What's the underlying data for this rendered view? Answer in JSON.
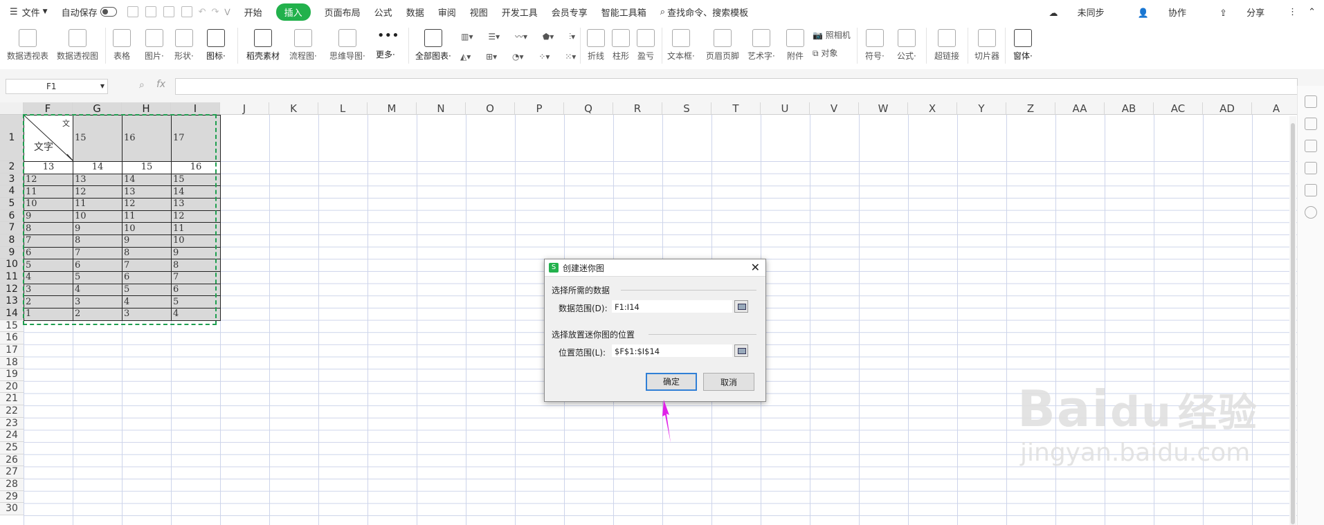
{
  "menubar": {
    "file_label": "文件",
    "autosave_label": "自动保存",
    "tabs": [
      {
        "label": "开始"
      },
      {
        "label": "插入"
      },
      {
        "label": "页面布局"
      },
      {
        "label": "公式"
      },
      {
        "label": "数据"
      },
      {
        "label": "审阅"
      },
      {
        "label": "视图"
      },
      {
        "label": "开发工具"
      },
      {
        "label": "会员专享"
      },
      {
        "label": "智能工具箱"
      }
    ],
    "search_placeholder": "查找命令、搜索模板",
    "right_items": [
      {
        "label": "未同步"
      },
      {
        "label": "协作"
      },
      {
        "label": "分享"
      }
    ]
  },
  "ribbon": {
    "buttons": [
      {
        "label": "数据透视表"
      },
      {
        "label": "数据透视图"
      },
      {
        "label": "表格"
      },
      {
        "label": "图片·"
      },
      {
        "label": "形状·"
      },
      {
        "label": "图标·"
      },
      {
        "label": "稻壳素材"
      },
      {
        "label": "流程图·"
      },
      {
        "label": "思维导图·"
      },
      {
        "label": "更多·"
      },
      {
        "label": "全部图表·"
      },
      {
        "label": "折线"
      },
      {
        "label": "柱形"
      },
      {
        "label": "盈亏"
      },
      {
        "label": "文本框·"
      },
      {
        "label": "页眉页脚"
      },
      {
        "label": "艺术字·"
      },
      {
        "label": "附件"
      },
      {
        "label": "照相机"
      },
      {
        "label": "对象"
      },
      {
        "label": "符号·"
      },
      {
        "label": "公式·"
      },
      {
        "label": "超链接"
      },
      {
        "label": "切片器"
      },
      {
        "label": "窗体·"
      }
    ]
  },
  "formula_bar": {
    "name_box": "F1",
    "fx_label": "fx",
    "formula": ""
  },
  "columns": [
    "F",
    "G",
    "H",
    "I",
    "J",
    "K",
    "L",
    "M",
    "N",
    "O",
    "P",
    "Q",
    "R",
    "S",
    "T",
    "U",
    "V",
    "W",
    "X",
    "Y",
    "Z",
    "AA",
    "AB",
    "AC",
    "AD",
    "A"
  ],
  "rows": [
    "1",
    "2",
    "3",
    "4",
    "5",
    "6",
    "7",
    "8",
    "9",
    "10",
    "11",
    "12",
    "13",
    "14",
    "15",
    "16",
    "17",
    "18",
    "19",
    "20",
    "21",
    "22",
    "23",
    "24",
    "25",
    "26",
    "27",
    "28",
    "29",
    "30"
  ],
  "table": {
    "diag_text": "文字",
    "diag_corner": "文",
    "row1": [
      "15",
      "16",
      "17"
    ],
    "row2": [
      "13",
      "14",
      "15",
      "16"
    ],
    "data": [
      [
        "12",
        "13",
        "14",
        "15"
      ],
      [
        "11",
        "12",
        "13",
        "14"
      ],
      [
        "10",
        "11",
        "12",
        "13"
      ],
      [
        "9",
        "10",
        "11",
        "12"
      ],
      [
        "8",
        "9",
        "10",
        "11"
      ],
      [
        "7",
        "8",
        "9",
        "10"
      ],
      [
        "6",
        "7",
        "8",
        "9"
      ],
      [
        "5",
        "6",
        "7",
        "8"
      ],
      [
        "4",
        "5",
        "6",
        "7"
      ],
      [
        "3",
        "4",
        "5",
        "6"
      ],
      [
        "2",
        "3",
        "4",
        "5"
      ],
      [
        "1",
        "2",
        "3",
        "4"
      ]
    ]
  },
  "dialog": {
    "title": "创建迷你图",
    "section1": "选择所需的数据",
    "data_range_label": "数据范围(D):",
    "data_range_value": "F1:I14",
    "section2": "选择放置迷你图的位置",
    "location_label": "位置范围(L):",
    "location_value": "$F$1:$I$14",
    "ok": "确定",
    "cancel": "取消",
    "close": "✕"
  },
  "watermark": {
    "brand": "Bai",
    "brand2": "du",
    "suffix": "经验",
    "url": "jingyan.baidu.com"
  },
  "colors": {
    "accent": "#22b14c",
    "selection_border": "#1e9e4f",
    "arrow": "#e020e8"
  }
}
